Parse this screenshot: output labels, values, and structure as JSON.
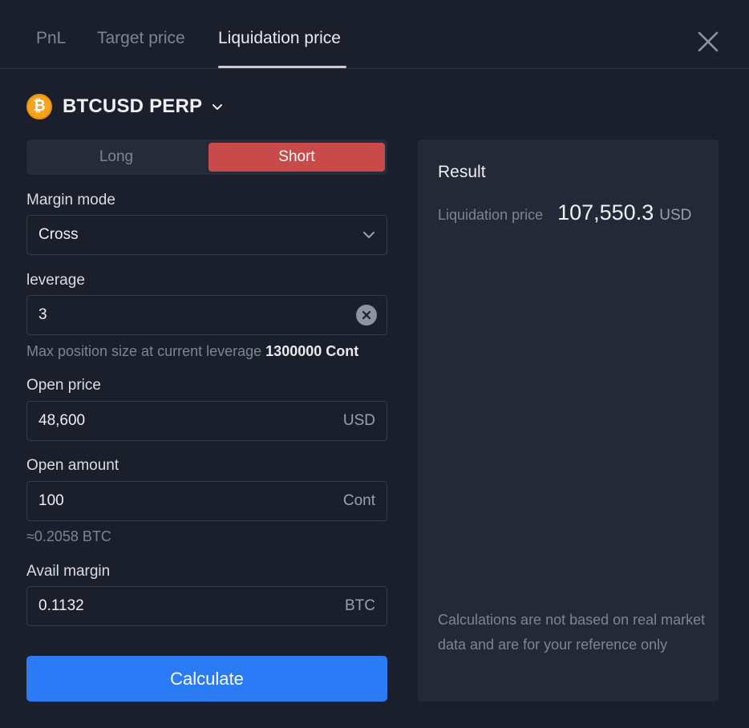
{
  "tabs": [
    {
      "label": "PnL"
    },
    {
      "label": "Target price"
    },
    {
      "label": "Liquidation price"
    }
  ],
  "active_tab": "Liquidation price",
  "symbol": {
    "name": "BTCUSD PERP",
    "coin_glyph": "₿"
  },
  "side": {
    "long_label": "Long",
    "short_label": "Short",
    "selected": "Short"
  },
  "margin_mode": {
    "label": "Margin mode",
    "value": "Cross"
  },
  "leverage": {
    "label": "leverage",
    "value": "3",
    "hint_prefix": "Max position size at current leverage",
    "hint_value": "1300000 Cont"
  },
  "open_price": {
    "label": "Open price",
    "value": "48,600",
    "unit": "USD"
  },
  "open_amount": {
    "label": "Open amount",
    "value": "100",
    "unit": "Cont",
    "approx": "≈0.2058 BTC"
  },
  "avail_margin": {
    "label": "Avail margin",
    "value": "0.1132",
    "unit": "BTC"
  },
  "calculate_label": "Calculate",
  "result": {
    "title": "Result",
    "label": "Liquidation price",
    "value": "107,550.3",
    "unit": "USD",
    "disclaimer": "Calculations are not based on real market data and are for your reference only"
  },
  "colors": {
    "background": "#1a1f2b",
    "short_accent": "#c84a4a",
    "primary_button": "#2b7bf6",
    "coin": "#f7a41c"
  },
  "icons": [
    "close-icon",
    "bitcoin-icon",
    "chevron-down-icon",
    "clear-icon"
  ]
}
